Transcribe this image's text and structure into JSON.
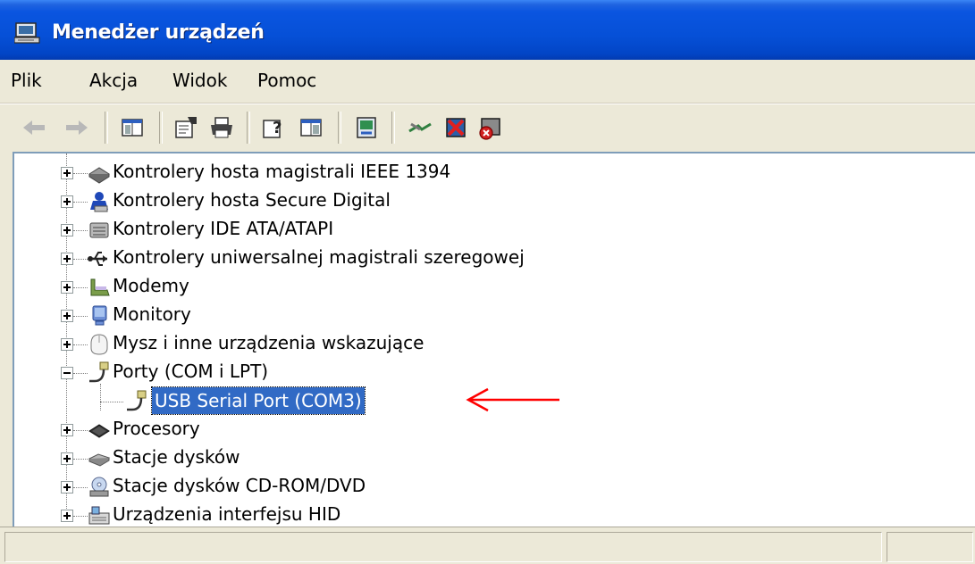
{
  "window": {
    "title": "Menedżer urządzeń"
  },
  "menu": [
    "Plik",
    "Akcja",
    "Widok",
    "Pomoc"
  ],
  "toolbar": {
    "buttons": [
      "back-icon",
      "forward-icon",
      "show-hide-tree-icon",
      "properties-icon",
      "print-icon",
      "help-icon",
      "console-tree-icon",
      "scan-hardware-icon",
      "update-driver-icon",
      "disable-device-icon",
      "uninstall-device-icon"
    ]
  },
  "tree": {
    "items": [
      {
        "label": "Kontrolery hosta magistrali IEEE 1394",
        "icon": "ieee1394-icon",
        "expanded": false
      },
      {
        "label": "Kontrolery hosta Secure Digital",
        "icon": "sd-host-icon",
        "expanded": false
      },
      {
        "label": "Kontrolery IDE ATA/ATAPI",
        "icon": "ide-controller-icon",
        "expanded": false
      },
      {
        "label": "Kontrolery uniwersalnej magistrali szeregowej",
        "icon": "usb-icon",
        "expanded": false
      },
      {
        "label": "Modemy",
        "icon": "modem-icon",
        "expanded": false
      },
      {
        "label": "Monitory",
        "icon": "monitor-icon",
        "expanded": false
      },
      {
        "label": "Mysz i inne urządzenia wskazujące",
        "icon": "mouse-icon",
        "expanded": false
      },
      {
        "label": "Porty (COM i LPT)",
        "icon": "port-icon",
        "expanded": true
      },
      {
        "label": "USB Serial Port (COM3)",
        "icon": "port-icon",
        "child": true,
        "selected": true
      },
      {
        "label": "Procesory",
        "icon": "processor-icon",
        "expanded": false
      },
      {
        "label": "Stacje dysków",
        "icon": "disk-drive-icon",
        "expanded": false
      },
      {
        "label": "Stacje dysków CD-ROM/DVD",
        "icon": "cdrom-icon",
        "expanded": false
      },
      {
        "label": "Urządzenia interfejsu HID",
        "icon": "hid-icon",
        "expanded": false
      }
    ]
  },
  "colors": {
    "titlebar": "#0650d7",
    "selection": "#316ac5",
    "annotation_arrow": "#ff0000"
  }
}
